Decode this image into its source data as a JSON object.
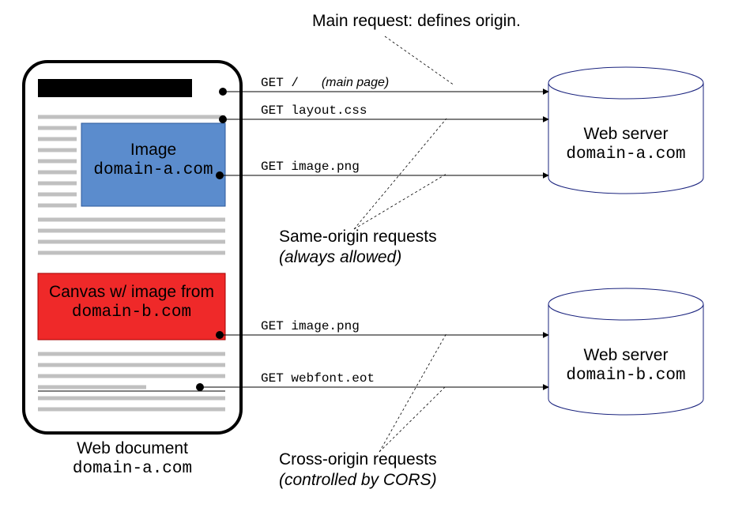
{
  "title_note": "Main request: defines origin.",
  "document_box": {
    "image_label_line1": "Image",
    "image_label_line2": "domain-a.com",
    "canvas_label_line1": "Canvas w/ image from",
    "canvas_label_line2": "domain-b.com",
    "caption_line1": "Web document",
    "caption_line2": "domain-a.com"
  },
  "requests": {
    "r1a": "GET /",
    "r1b": "(main page)",
    "r2": "GET layout.css",
    "r3": "GET image.png",
    "r4": "GET image.png",
    "r5": "GET webfont.eot"
  },
  "same_origin": {
    "line1": "Same-origin requests",
    "line2": "(always allowed)"
  },
  "cross_origin": {
    "line1": "Cross-origin requests",
    "line2": "(controlled by CORS)"
  },
  "server_a": {
    "line1": "Web server",
    "line2": "domain-a.com"
  },
  "server_b": {
    "line1": "Web server",
    "line2": "domain-b.com"
  }
}
